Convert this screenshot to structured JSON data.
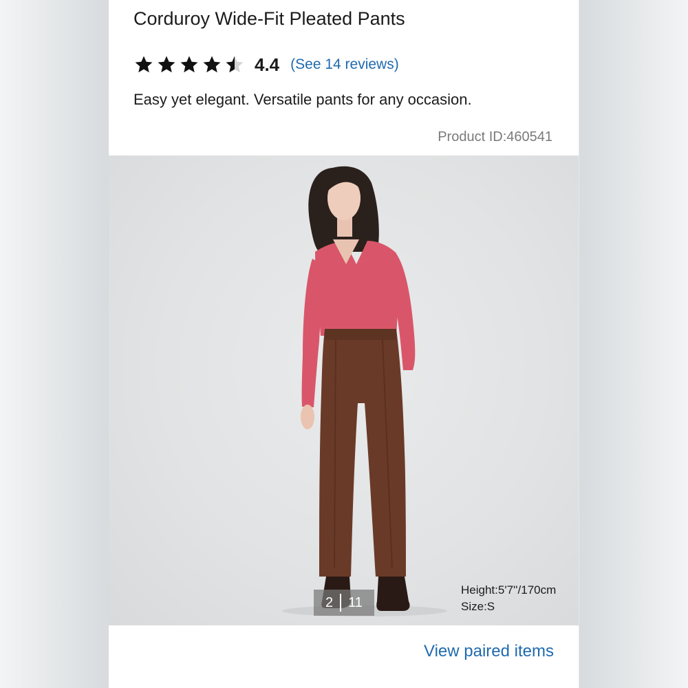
{
  "product": {
    "title": "Corduroy Wide-Fit Pleated Pants",
    "rating": {
      "value": "4.4",
      "stars_out_of_5": 4.4,
      "reviews_link": "(See 14 reviews)"
    },
    "tagline": "Easy yet elegant. Versatile pants for any occasion.",
    "product_id": "Product ID:460541"
  },
  "gallery": {
    "current": "2",
    "total": "11",
    "model_height": "Height:5'7''/170cm",
    "model_size": "Size:S"
  },
  "actions": {
    "view_paired": "View paired items"
  },
  "colors": {
    "link": "#1f6aae",
    "sweater": "#d9566a",
    "pants": "#6a3a28"
  }
}
